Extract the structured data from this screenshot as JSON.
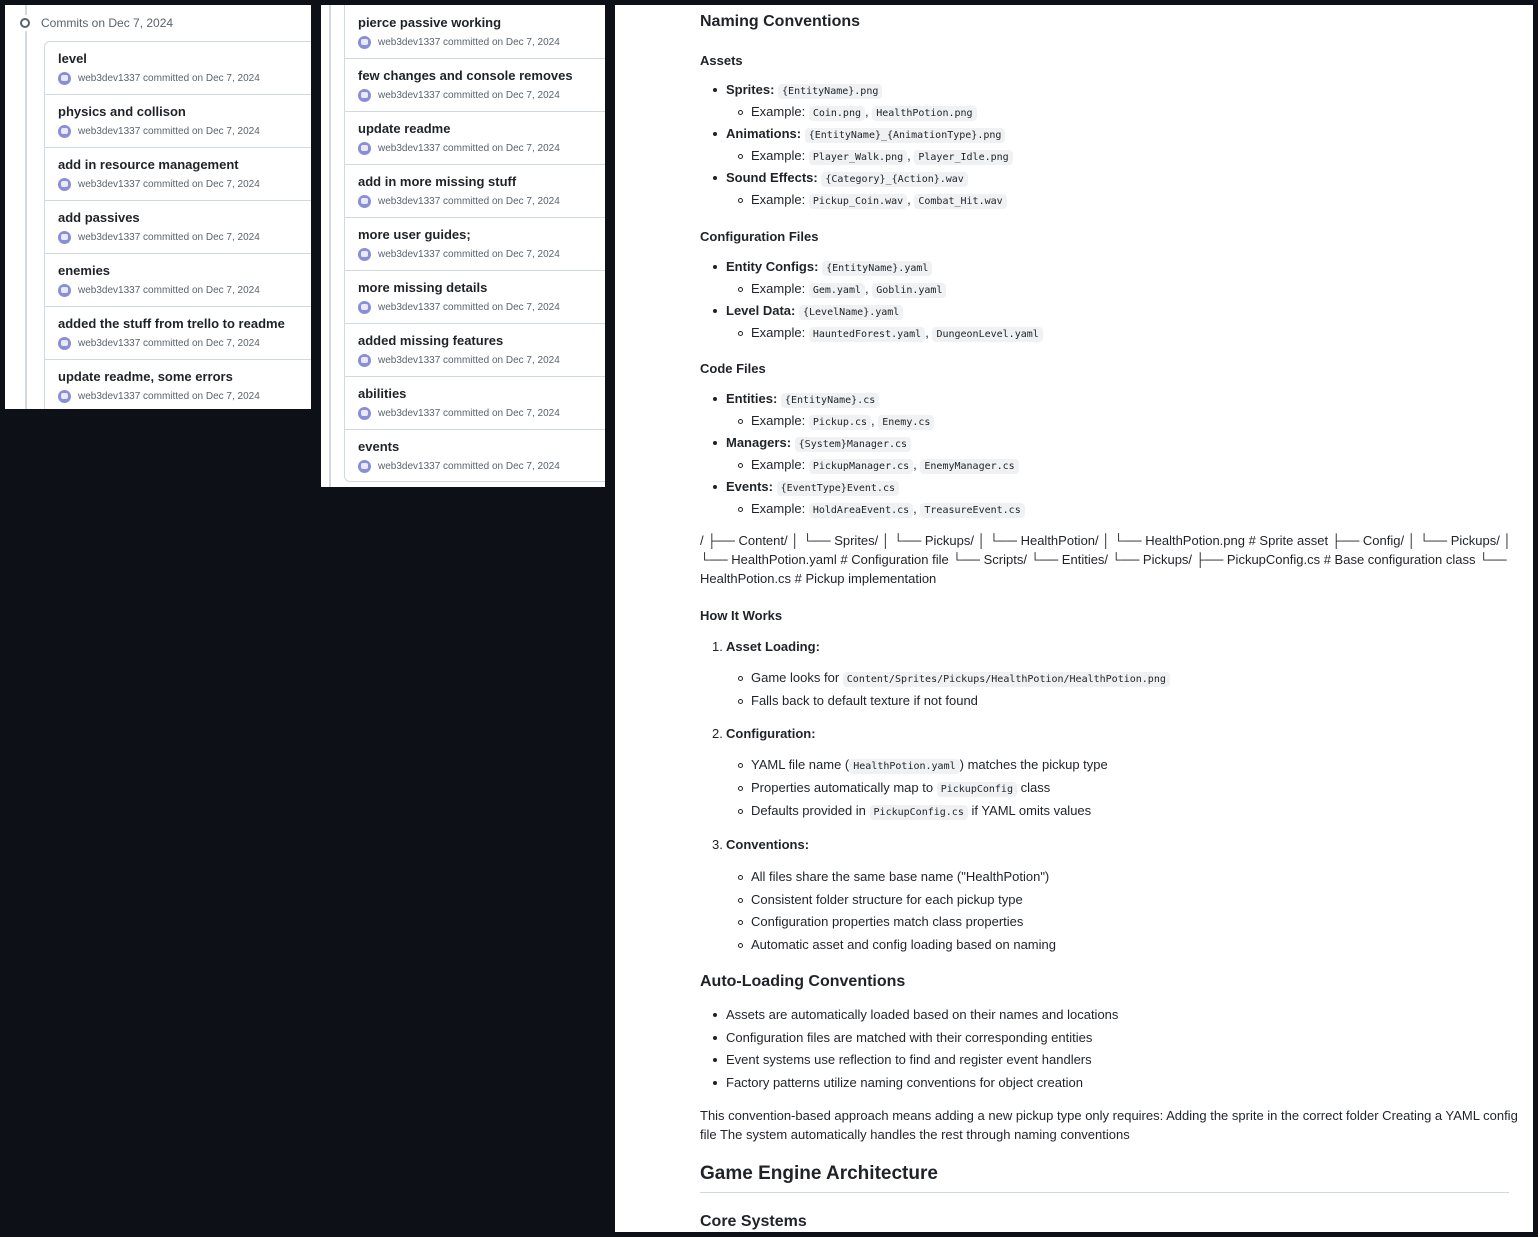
{
  "left_panel": {
    "heading": "Commits on Dec 7, 2024",
    "commits": [
      {
        "title": "level",
        "meta": "web3dev1337 committed on Dec 7, 2024"
      },
      {
        "title": "physics and collison",
        "meta": "web3dev1337 committed on Dec 7, 2024"
      },
      {
        "title": "add in resource management",
        "meta": "web3dev1337 committed on Dec 7, 2024"
      },
      {
        "title": "add passives",
        "meta": "web3dev1337 committed on Dec 7, 2024"
      },
      {
        "title": "enemies",
        "meta": "web3dev1337 committed on Dec 7, 2024"
      },
      {
        "title": "added the stuff from trello to readme",
        "meta": "web3dev1337 committed on Dec 7, 2024"
      },
      {
        "title": "update readme, some errors",
        "meta": "web3dev1337 committed on Dec 7, 2024"
      }
    ]
  },
  "middle_panel": {
    "commits": [
      {
        "title": "pierce passive working",
        "meta": "web3dev1337 committed on Dec 7, 2024"
      },
      {
        "title": "few changes and console removes",
        "meta": "web3dev1337 committed on Dec 7, 2024"
      },
      {
        "title": "update readme",
        "meta": "web3dev1337 committed on Dec 7, 2024"
      },
      {
        "title": "add in more missing stuff",
        "meta": "web3dev1337 committed on Dec 7, 2024"
      },
      {
        "title": "more user guides;",
        "meta": "web3dev1337 committed on Dec 7, 2024"
      },
      {
        "title": "more missing details",
        "meta": "web3dev1337 committed on Dec 7, 2024"
      },
      {
        "title": "added missing features",
        "meta": "web3dev1337 committed on Dec 7, 2024"
      },
      {
        "title": "abilities",
        "meta": "web3dev1337 committed on Dec 7, 2024"
      },
      {
        "title": "events",
        "meta": "web3dev1337 committed on Dec 7, 2024"
      }
    ]
  },
  "readme": {
    "naming_title": "Naming Conventions",
    "assets_title": "Assets",
    "sprites_label": "Sprites:",
    "sprites_code": "{EntityName}.png",
    "example_label": "Example:",
    "sprites_ex1": "Coin.png",
    "sprites_ex2": "HealthPotion.png",
    "anim_label": "Animations:",
    "anim_code": "{EntityName}_{AnimationType}.png",
    "anim_ex1": "Player_Walk.png",
    "anim_ex2": "Player_Idle.png",
    "sound_label": "Sound Effects:",
    "sound_code": "{Category}_{Action}.wav",
    "sound_ex1": "Pickup_Coin.wav",
    "sound_ex2": "Combat_Hit.wav",
    "config_title": "Configuration Files",
    "entcfg_label": "Entity Configs:",
    "entcfg_code": "{EntityName}.yaml",
    "entcfg_ex1": "Gem.yaml",
    "entcfg_ex2": "Goblin.yaml",
    "level_label": "Level Data:",
    "level_code": "{LevelName}.yaml",
    "level_ex1": "HauntedForest.yaml",
    "level_ex2": "DungeonLevel.yaml",
    "code_title": "Code Files",
    "entities_label": "Entities:",
    "entities_code": "{EntityName}.cs",
    "entities_ex1": "Pickup.cs",
    "entities_ex2": "Enemy.cs",
    "managers_label": "Managers:",
    "managers_code": "{System}Manager.cs",
    "managers_ex1": "PickupManager.cs",
    "managers_ex2": "EnemyManager.cs",
    "events_label": "Events:",
    "events_code": "{EventType}Event.cs",
    "events_ex1": "HoldAreaEvent.cs",
    "events_ex2": "TreasureEvent.cs",
    "tree_line1": "/ ├── Content/ │ └── Sprites/ │ └── Pickups/ │ └── HealthPotion/ │ └── HealthPotion.png # Sprite asset ├── Config/ │ └── Pickups/ │",
    "tree_line2": "└── HealthPotion.yaml # Configuration file └── Scripts/ └── Entities/ └── Pickups/ ├── PickupConfig.cs # Base configuration class └──",
    "tree_line3": "HealthPotion.cs # Pickup implementation",
    "how_title": "How It Works",
    "step1_num": "1.",
    "step1_title": "Asset Loading:",
    "step1_a_pre": "Game looks for",
    "step1_a_code": "Content/Sprites/Pickups/HealthPotion/HealthPotion.png",
    "step1_b": "Falls back to default texture if not found",
    "step2_num": "2.",
    "step2_title": "Configuration:",
    "step2_a_pre": "YAML file name (",
    "step2_a_code": "HealthPotion.yaml",
    "step2_a_post": ") matches the pickup type",
    "step2_b_pre": "Properties automatically map to",
    "step2_b_code": "PickupConfig",
    "step2_b_post": "class",
    "step2_c_pre": "Defaults provided in",
    "step2_c_code": "PickupConfig.cs",
    "step2_c_post": "if YAML omits values",
    "step3_num": "3.",
    "step3_title": "Conventions:",
    "step3_items": [
      "All files share the same base name (\"HealthPotion\")",
      "Consistent folder structure for each pickup type",
      "Configuration properties match class properties",
      "Automatic asset and config loading based on naming"
    ],
    "autoload_title": "Auto-Loading Conventions",
    "autoload_items": [
      "Assets are automatically loaded based on their names and locations",
      "Configuration files are matched with their corresponding entities",
      "Event systems use reflection to find and register event handlers",
      "Factory patterns utilize naming conventions for object creation"
    ],
    "summary_line1": "This convention-based approach means adding a new pickup type only requires: Adding the sprite in the correct folder Creating a YAML config",
    "summary_line2": "file The system automatically handles the rest through naming conventions",
    "engine_title": "Game Engine Architecture",
    "core_title": "Core Systems"
  }
}
